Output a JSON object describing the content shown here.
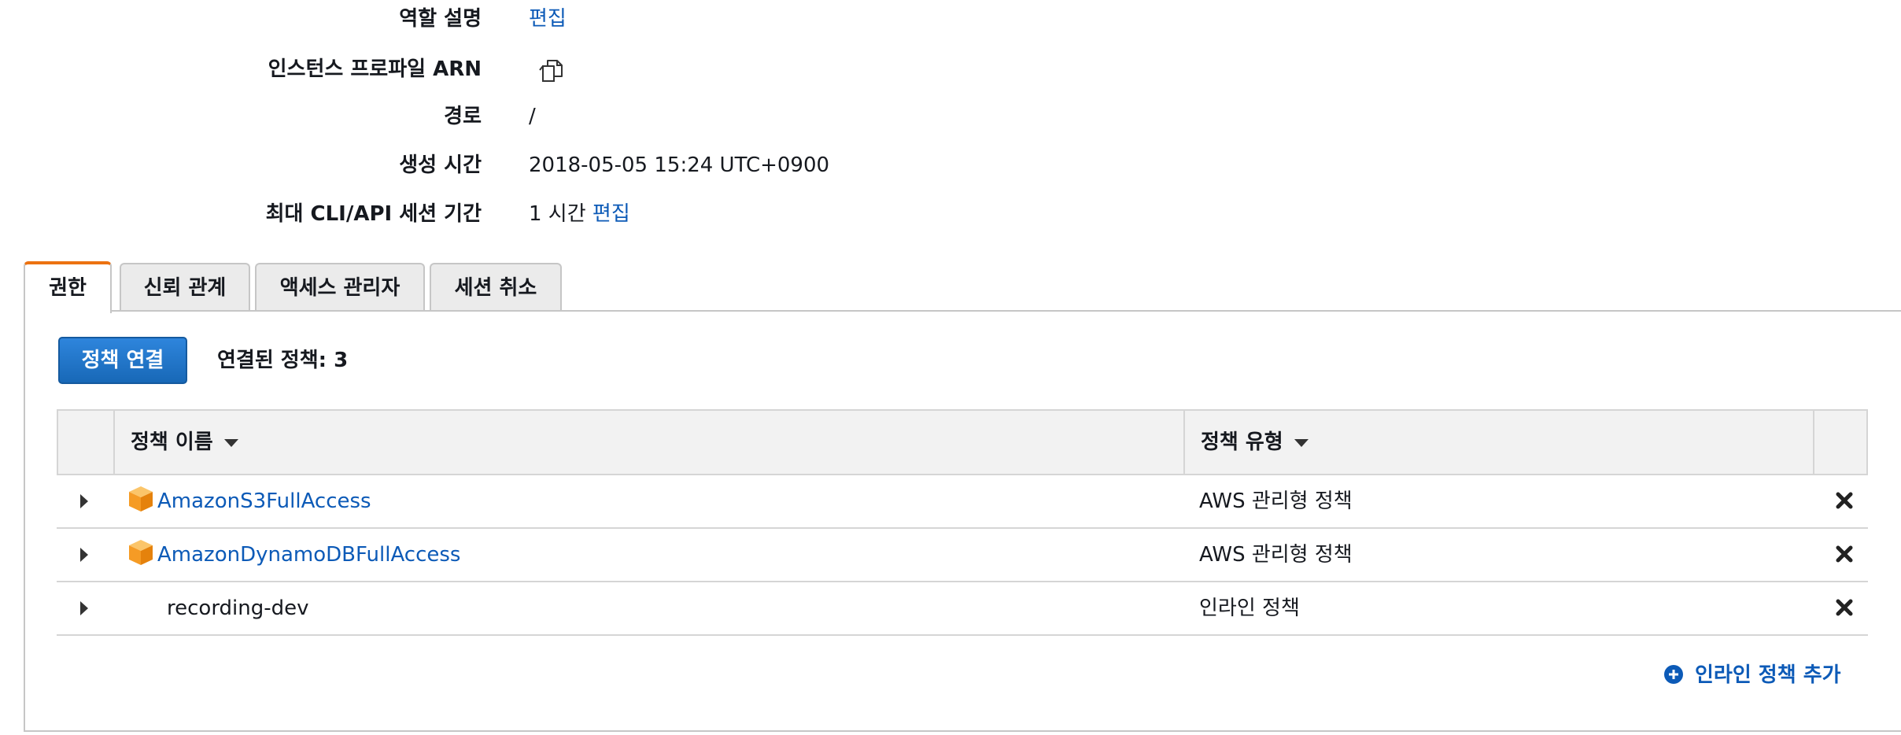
{
  "summary": {
    "role_description": {
      "label": "역할 설명",
      "edit": "편집"
    },
    "instance_profile_arn": {
      "label": "인스턴스 프로파일 ARN",
      "icon": "copy-icon"
    },
    "path": {
      "label": "경로",
      "value": "/"
    },
    "creation_time": {
      "label": "생성 시간",
      "value": "2018-05-05 15:24 UTC+0900"
    },
    "max_session": {
      "label": "최대 CLI/API 세션 기간",
      "value": "1 시간",
      "edit": "편집"
    }
  },
  "tabs": [
    {
      "label": "권한",
      "active": true
    },
    {
      "label": "신뢰 관계",
      "active": false
    },
    {
      "label": "액세스 관리자",
      "active": false
    },
    {
      "label": "세션 취소",
      "active": false
    }
  ],
  "permissions": {
    "attach_button": "정책 연결",
    "attached_count": "연결된 정책: 3",
    "columns": {
      "name": "정책 이름",
      "type": "정책 유형"
    },
    "rows": [
      {
        "name": "AmazonS3FullAccess",
        "type": "AWS 관리형 정책",
        "icon": "aws-box-icon",
        "is_link": true
      },
      {
        "name": "AmazonDynamoDBFullAccess",
        "type": "AWS 관리형 정책",
        "icon": "aws-box-icon",
        "is_link": true
      },
      {
        "name": "recording-dev",
        "type": "인라인 정책",
        "icon": "",
        "is_link": false
      }
    ],
    "add_inline": "인라인 정책 추가"
  },
  "colors": {
    "link": "#0c5ab7",
    "primary_button": "#1f74c9",
    "active_tab_accent": "#ec7211",
    "aws_box": "#f59b25"
  }
}
